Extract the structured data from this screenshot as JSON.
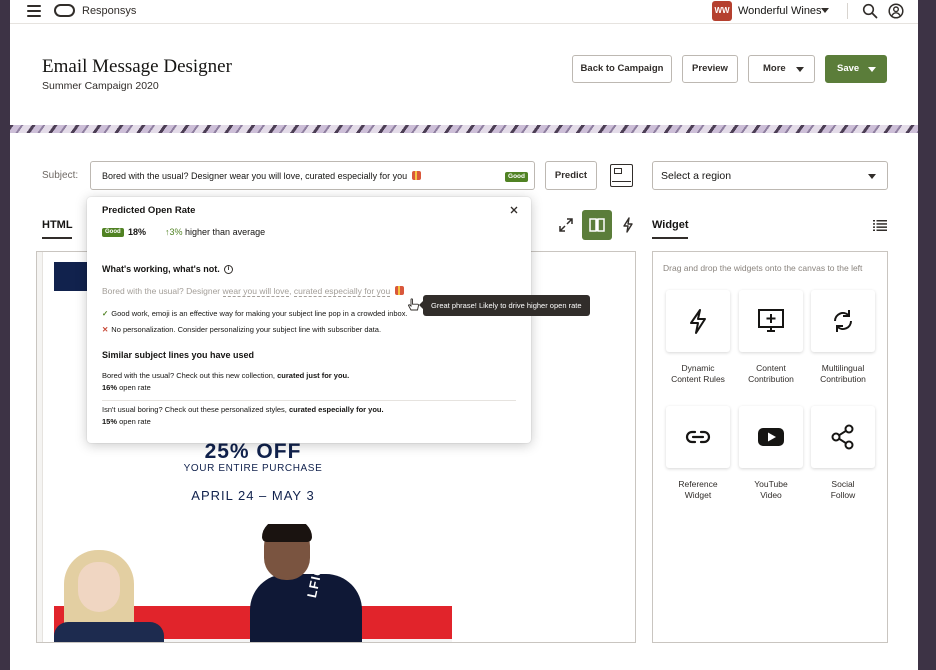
{
  "app": {
    "brand": "Responsys",
    "account_name": "Wonderful Wines",
    "account_initials": "WW"
  },
  "header": {
    "title": "Email Message Designer",
    "subtitle": "Summer Campaign 2020",
    "buttons": {
      "back": "Back to Campaign",
      "preview": "Preview",
      "more": "More",
      "save": "Save"
    }
  },
  "subject": {
    "label": "Subject:",
    "value": "Bored with the usual? Designer wear you will love, curated especially for you",
    "badge": "Good",
    "predict_label": "Predict",
    "region_placeholder": "Select a region"
  },
  "editor": {
    "tab_html": "HTML"
  },
  "popover": {
    "title": "Predicted Open Rate",
    "badge": "Good",
    "rate": "18%",
    "delta_arrow": "↑",
    "delta_pct": "3%",
    "delta_text": "higher than average",
    "working_title": "What's working, what's not.",
    "faded_a": "Bored with the usual? Designer ",
    "faded_b": "wear you will love",
    "faded_c": ", ",
    "faded_d": "curated especially for you",
    "ok_text": "Good work, emoji is an effective way for making your subject line pop in a crowded inbox.",
    "no_text": "No personalization. Consider personalizing your subject line with subscriber data.",
    "similar_title": "Similar subject lines you have used",
    "similar": [
      {
        "text": "Bored with the usual? Check out this new collection, ",
        "bold": "curated just for you.",
        "rate": "16%",
        "rate_text": "open rate"
      },
      {
        "text": "Isn't usual boring? Check out these personalized styles, ",
        "bold": "curated especially for you.",
        "rate": "15%",
        "rate_text": "open rate"
      }
    ],
    "tooltip": "Great phrase! Likely to drive higher open rate"
  },
  "email": {
    "offer": "25% OFF",
    "offer_sub": "YOUR ENTIRE PURCHASE",
    "dates": "APRIL 24 – MAY 3",
    "shirt_text": "LFIGER"
  },
  "widgets": {
    "tab": "Widget",
    "hint": "Drag and drop the widgets onto the canvas to the left",
    "items": [
      {
        "line1": "Dynamic",
        "line2": "Content Rules",
        "icon": "bolt-icon"
      },
      {
        "line1": "Content",
        "line2": "Contribution",
        "icon": "monitor-plus-icon"
      },
      {
        "line1": "Multilingual",
        "line2": "Contribution",
        "icon": "refresh-icon"
      },
      {
        "line1": "Reference",
        "line2": "Widget",
        "icon": "link-icon"
      },
      {
        "line1": "YouTube",
        "line2": "Video",
        "icon": "youtube-icon"
      },
      {
        "line1": "Social",
        "line2": "Follow",
        "icon": "share-icon"
      }
    ]
  },
  "colors": {
    "primary": "#5b7d3a",
    "good": "#508223",
    "error": "#c74634",
    "text": "#161513"
  }
}
